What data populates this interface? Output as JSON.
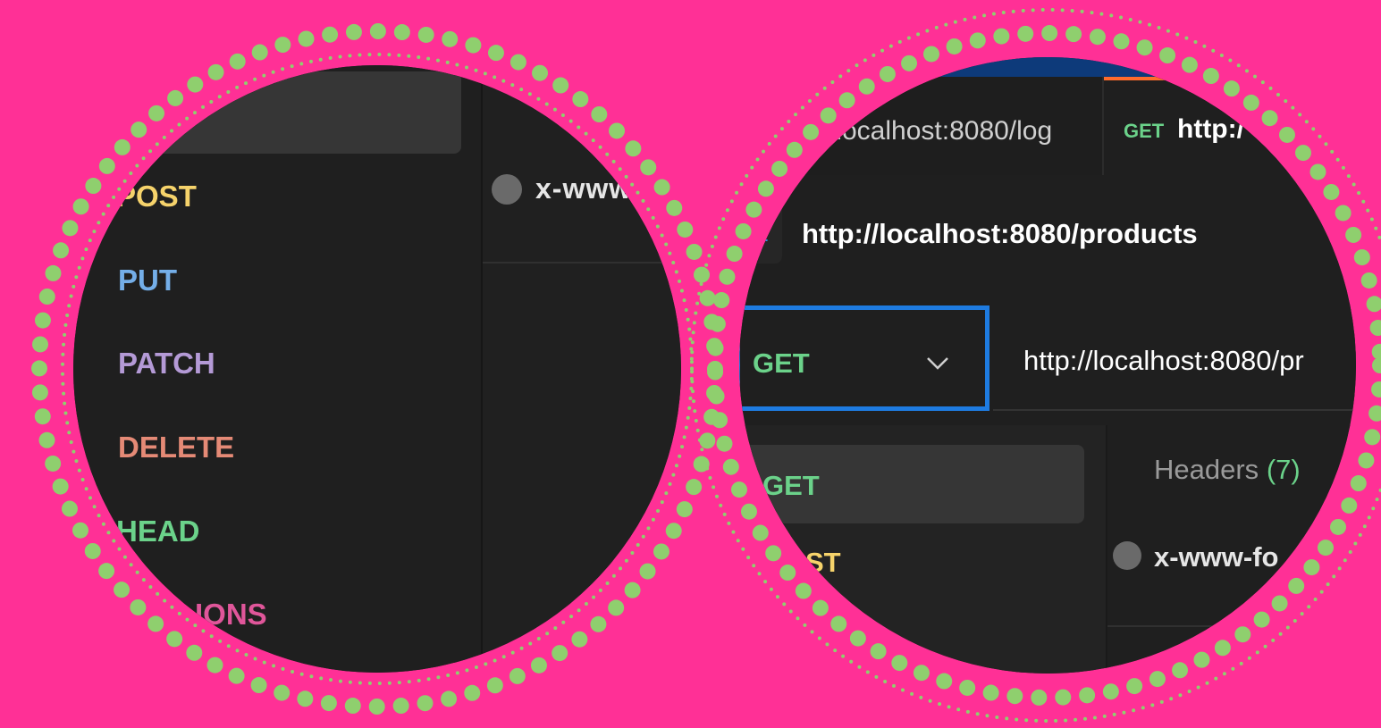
{
  "colors": {
    "background": "#ff3096",
    "ring": "#8fcf6e",
    "panel": "#1f1f1f",
    "get": "#6bd28a",
    "post": "#f6d36b",
    "put": "#74aee8",
    "patch": "#b49ad6",
    "delete": "#e58a76",
    "head": "#6bd28a",
    "options": "#e0569a",
    "focus": "#1e7be0",
    "tab_accent": "#ff6b2c"
  },
  "left_zoom": {
    "method_menu": {
      "items": [
        {
          "label": "POST",
          "color_key": "post"
        },
        {
          "label": "PUT",
          "color_key": "put"
        },
        {
          "label": "PATCH",
          "color_key": "patch"
        },
        {
          "label": "DELETE",
          "color_key": "delete"
        },
        {
          "label": "HEAD",
          "color_key": "head"
        },
        {
          "label": "IONS",
          "color_key": "options"
        }
      ]
    },
    "body_type_option": "x-www"
  },
  "right_zoom": {
    "tabs": [
      {
        "label": "/localhost:8080/log",
        "method": ""
      },
      {
        "label": "http:/",
        "method": "GET"
      }
    ],
    "request_name": "http://localhost:8080/products",
    "request_name_icon_fragment": "2",
    "method_select": {
      "selected": "GET"
    },
    "url_input": {
      "value": "http://localhost:8080/pr"
    },
    "method_dropdown": {
      "items": [
        "GET",
        "ST"
      ]
    },
    "headers_tab": {
      "label": "Headers",
      "count": "(7)"
    },
    "body_type_option": "x-www-fo"
  }
}
